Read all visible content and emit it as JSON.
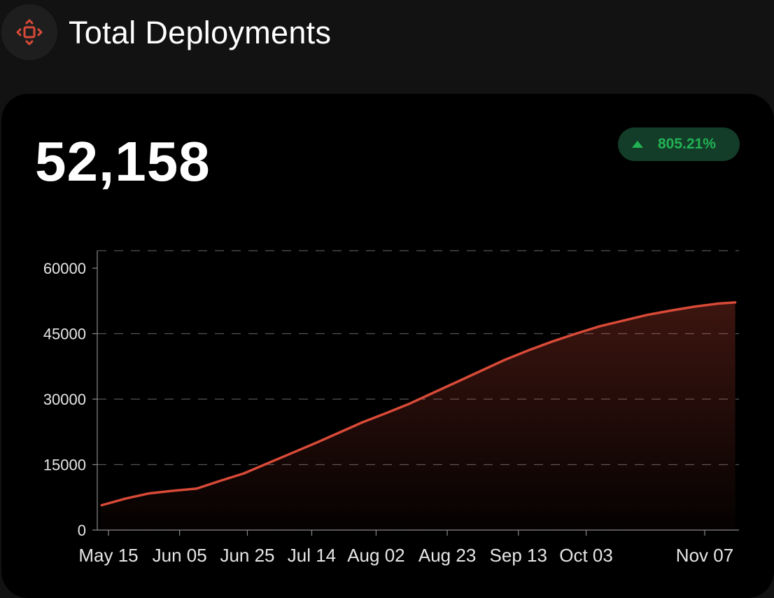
{
  "header": {
    "title": "Total Deployments",
    "icon": "move-arrows-icon"
  },
  "card": {
    "value": "52,158",
    "change": "805.21%",
    "change_direction": "up"
  },
  "colors": {
    "line": "#d94a38",
    "accent_icon": "#d94a38",
    "badge_bg": "#133d28",
    "badge_text": "#22b255",
    "grid": "#555555"
  },
  "chart_data": {
    "type": "area",
    "title": "",
    "xlabel": "",
    "ylabel": "",
    "ylim": [
      0,
      60000
    ],
    "y_ticks": [
      0,
      15000,
      30000,
      45000,
      60000
    ],
    "x_ticks": [
      "May 15",
      "Jun 05",
      "Jun 25",
      "Jul 14",
      "Aug 02",
      "Aug 23",
      "Sep 13",
      "Oct 03",
      "Nov 07"
    ],
    "x_tick_dates": [
      "2023-05-15",
      "2023-06-05",
      "2023-06-25",
      "2023-07-14",
      "2023-08-02",
      "2023-08-23",
      "2023-09-13",
      "2023-10-03",
      "2023-11-07"
    ],
    "grid": true,
    "series": [
      {
        "x": [
          "2023-05-13",
          "2023-05-20",
          "2023-05-27",
          "2023-06-03",
          "2023-06-10",
          "2023-06-17",
          "2023-06-24",
          "2023-07-01",
          "2023-07-08",
          "2023-07-15",
          "2023-07-22",
          "2023-07-29",
          "2023-08-05",
          "2023-08-12",
          "2023-08-19",
          "2023-08-26",
          "2023-09-02",
          "2023-09-09",
          "2023-09-16",
          "2023-09-23",
          "2023-09-30",
          "2023-10-07",
          "2023-10-14",
          "2023-10-21",
          "2023-10-28",
          "2023-11-04",
          "2023-11-11",
          "2023-11-16"
        ],
        "values": [
          5700,
          7200,
          8400,
          9000,
          9500,
          11300,
          13000,
          15300,
          17600,
          19900,
          22300,
          24700,
          26800,
          29000,
          31500,
          34000,
          36500,
          39000,
          41200,
          43200,
          45000,
          46700,
          48000,
          49300,
          50300,
          51200,
          51900,
          52158
        ]
      }
    ]
  }
}
